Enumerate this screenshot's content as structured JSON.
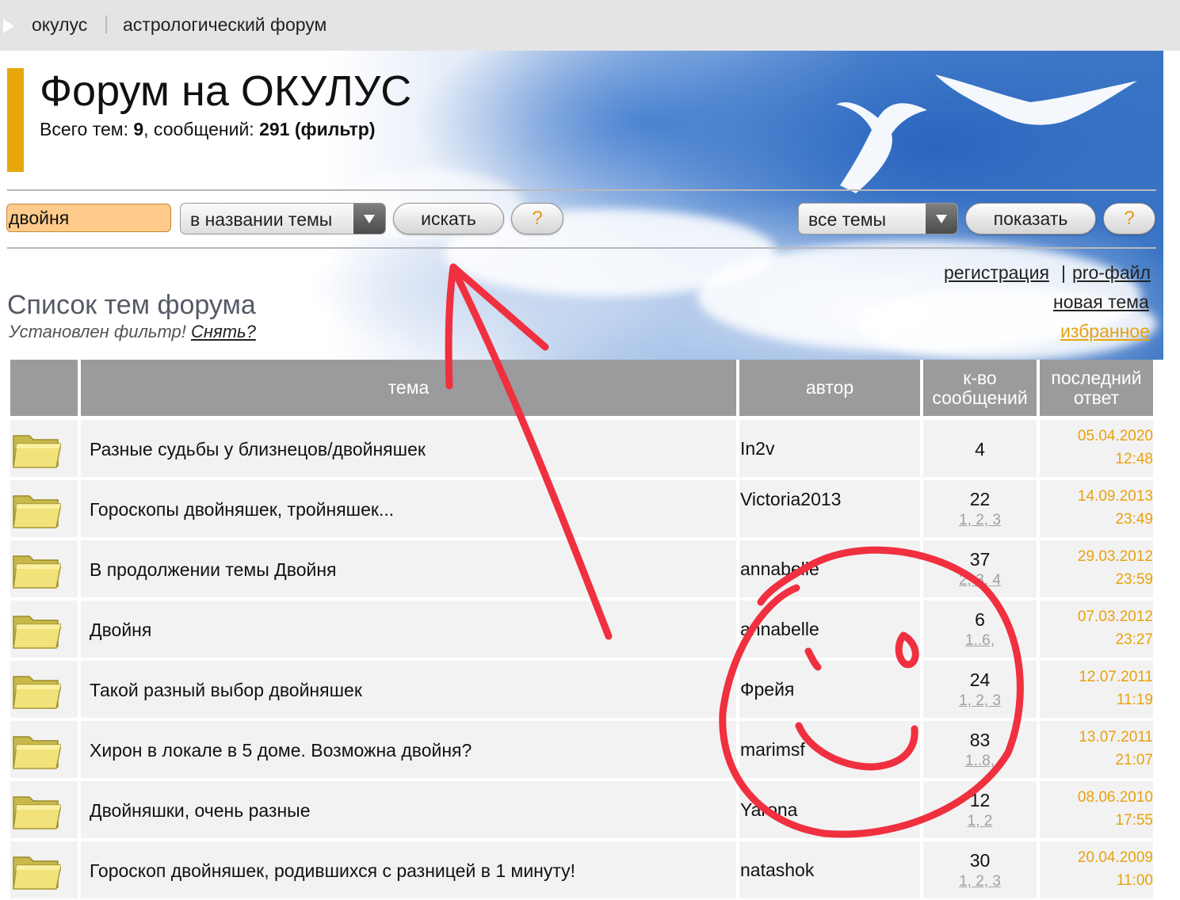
{
  "breadcrumb": {
    "site": "окулус",
    "separator": "|",
    "section": "астрологический форум"
  },
  "header": {
    "title": "Форум на ОКУЛУС",
    "stats_prefix": "Всего тем: ",
    "topics": "9",
    "stats_mid": ", сообщений: ",
    "messages": "291",
    "filter_label": "(фильтр)"
  },
  "search": {
    "query": "двойня",
    "scope": "в названии темы",
    "search_button": "искать",
    "help": "?",
    "topics_filter": "все темы",
    "show_button": "показать",
    "help2": "?"
  },
  "links": {
    "register": "регистрация",
    "separator": "|",
    "profile": "pro-файл",
    "new_topic": "новая тема",
    "favorites": "избранное"
  },
  "list": {
    "title": "Список тем форума",
    "filter_text": "Установлен фильтр! ",
    "filter_clear": "Снять?"
  },
  "table": {
    "headers": {
      "topic": "тема",
      "author": "автор",
      "count": "к-во сообщений",
      "last": "последний ответ"
    },
    "rows": [
      {
        "topic": "Разные судьбы у близнецов/двойняшек",
        "author": "In2v",
        "count": "4",
        "pages": "",
        "date": "05.04.2020",
        "time": "12:48"
      },
      {
        "topic": "Гороскопы двойняшек, тройняшек...",
        "author": "Victoria2013",
        "count": "22",
        "pages": "1, 2, 3",
        "date": "14.09.2013",
        "time": "23:49"
      },
      {
        "topic": "В продолжении темы Двойня",
        "author": "annabelle",
        "count": "37",
        "pages": "2, 3, 4",
        "date": "29.03.2012",
        "time": "23:59"
      },
      {
        "topic": "Двойня",
        "author": "annabelle",
        "count": "6",
        "pages": "1..6,",
        "date": "07.03.2012",
        "time": "23:27"
      },
      {
        "topic": "Такой разный выбор двойняшек",
        "author": "Фрейя",
        "count": "24",
        "pages": "1, 2, 3",
        "date": "12.07.2011",
        "time": "11:19"
      },
      {
        "topic": "Хирон в локале в 5 доме. Возможна двойня?",
        "author": "marimsf",
        "count": "83",
        "pages": "1..8,",
        "date": "13.07.2011",
        "time": "21:07"
      },
      {
        "topic": "Двойняшки, очень разные",
        "author": "Yarona",
        "count": "12",
        "pages": "1, 2",
        "date": "08.06.2010",
        "time": "17:55"
      },
      {
        "topic": "Гороскоп двойняшек, родившихся с разницей в 1 минуту!",
        "author": "natashok",
        "count": "30",
        "pages": "1, 2, 3",
        "date": "20.04.2009",
        "time": "11:00"
      }
    ]
  },
  "colors": {
    "accent": "#e8a60c",
    "link_orange": "#e8a20e",
    "header_gray": "#9b9b9d",
    "row_bg": "#f2f2f3",
    "annotation_red": "#f0303f"
  }
}
